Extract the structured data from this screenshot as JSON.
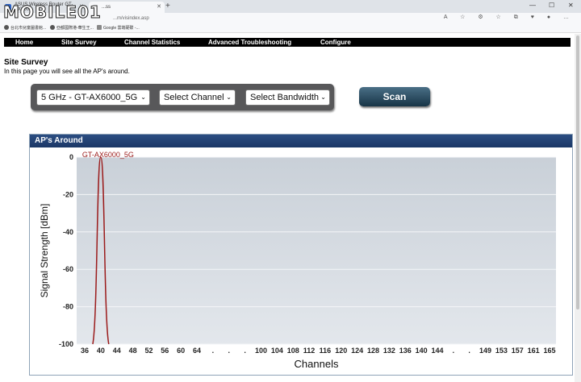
{
  "browser": {
    "tabs": [
      {
        "label": "ASUS Wireless Router GT-AX600..."
      },
      {
        "label": "...ss"
      }
    ],
    "new_tab_symbol": "+",
    "tab_close_symbol": "✕",
    "window_controls": [
      "—",
      "☐",
      "✕"
    ],
    "url": "...m/visindex.asp",
    "toolbar_icons": "A  ☆  ⚙  ☆  ⧉  ♥  ●  …",
    "bookmarks": [
      "台北市兒童圖書館...",
      "亞都國際港-華生王...",
      "Google 雲端硬碟 -..."
    ],
    "logo_text": "MOBILE01"
  },
  "nav": {
    "items": [
      "Home",
      "Site Survey",
      "Channel Statistics",
      "Advanced Troubleshooting",
      "Configure"
    ]
  },
  "page": {
    "title": "Site Survey",
    "description": "In this page you will see all the AP's around."
  },
  "controls": {
    "network_select": "5 GHz - GT-AX6000_5G",
    "channel_select": "Select Channel",
    "bandwidth_select": "Select Bandwidth",
    "chevron": "⌄",
    "scan_button": "Scan"
  },
  "panel": {
    "title": "AP's Around"
  },
  "colors": {
    "nav_bg": "#000000",
    "header_bg": "#1f3d6e",
    "curve": "#9b1b1b",
    "plot_bg": "#d3d9e0"
  },
  "chart_data": {
    "type": "line",
    "title": "",
    "xlabel": "Channels",
    "ylabel": "Signal Strength [dBm]",
    "ylim": [
      -100,
      0
    ],
    "yticks": [
      0,
      -20,
      -40,
      -60,
      -80,
      -100
    ],
    "x_tick_labels": [
      "36",
      "40",
      "44",
      "48",
      "52",
      "56",
      "60",
      "64",
      ".",
      ".",
      ".",
      "100",
      "104",
      "108",
      "112",
      "116",
      "120",
      "124",
      "128",
      "132",
      "136",
      "140",
      "144",
      ".",
      ".",
      "149",
      "153",
      "157",
      "161",
      "165"
    ],
    "series": [
      {
        "name": "GT-AX6000_5G",
        "center_channel": 40,
        "peak": 0,
        "floor": -100
      }
    ],
    "grid": true
  }
}
